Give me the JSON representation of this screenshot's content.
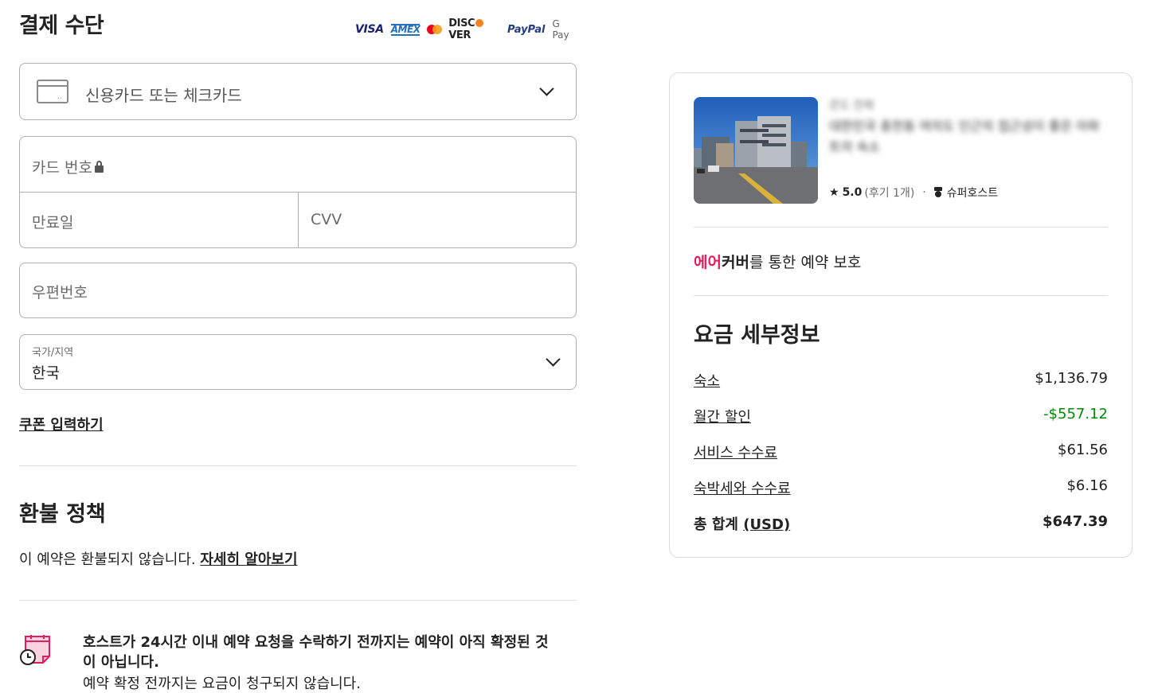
{
  "payment": {
    "title": "결제 수단",
    "logos": {
      "visa": "VISA",
      "amex": "AMEX",
      "discover_pre": "DISC",
      "discover_post": "VER",
      "paypal": "PayPal",
      "gpay": "G Pay"
    },
    "method": "신용카드 또는 체크카드",
    "card_number_placeholder": "카드 번호",
    "expiry_placeholder": "만료일",
    "cvv_placeholder": "CVV",
    "zip_placeholder": "우편번호",
    "country_label": "국가/지역",
    "country_value": "한국",
    "coupon_link": "쿠폰 입력하기"
  },
  "refund": {
    "title": "환불 정책",
    "text": "이 예약은 환불되지 않습니다. ",
    "link": "자세히 알아보기"
  },
  "notice": {
    "text": "호스트가 24시간 이내 예약 요청을 수락하기 전까지는 예약이 아직 확정된 것이 아닙니다.",
    "sub": "예약 확정 전까지는 요금이 청구되지 않습니다."
  },
  "listing": {
    "type": "콘도 전체",
    "name": "대한민국 충천동 여의도 인근의 접근성이 좋은 아파트의 숙소",
    "rating": "5.0",
    "reviews": "(후기 1개)",
    "separator": "·",
    "badge": "슈퍼호스트"
  },
  "aircover": {
    "red": "에어",
    "black": "커버",
    "rest": "를 통한 예약 보호"
  },
  "price_details": {
    "title": "요금 세부정보",
    "rows": [
      {
        "label": "숙소",
        "value": "$1,136.79"
      },
      {
        "label": "월간 할인",
        "value": "-$557.12"
      },
      {
        "label": "서비스 수수료",
        "value": "$61.56"
      },
      {
        "label": "숙박세와 수수료",
        "value": "$6.16"
      }
    ],
    "total_label": "총 합계 ",
    "total_currency": "(USD)",
    "total_value": "$647.39"
  },
  "colors": {
    "brand": "#e31c5f",
    "discount": "#008a05",
    "text": "#222222"
  }
}
